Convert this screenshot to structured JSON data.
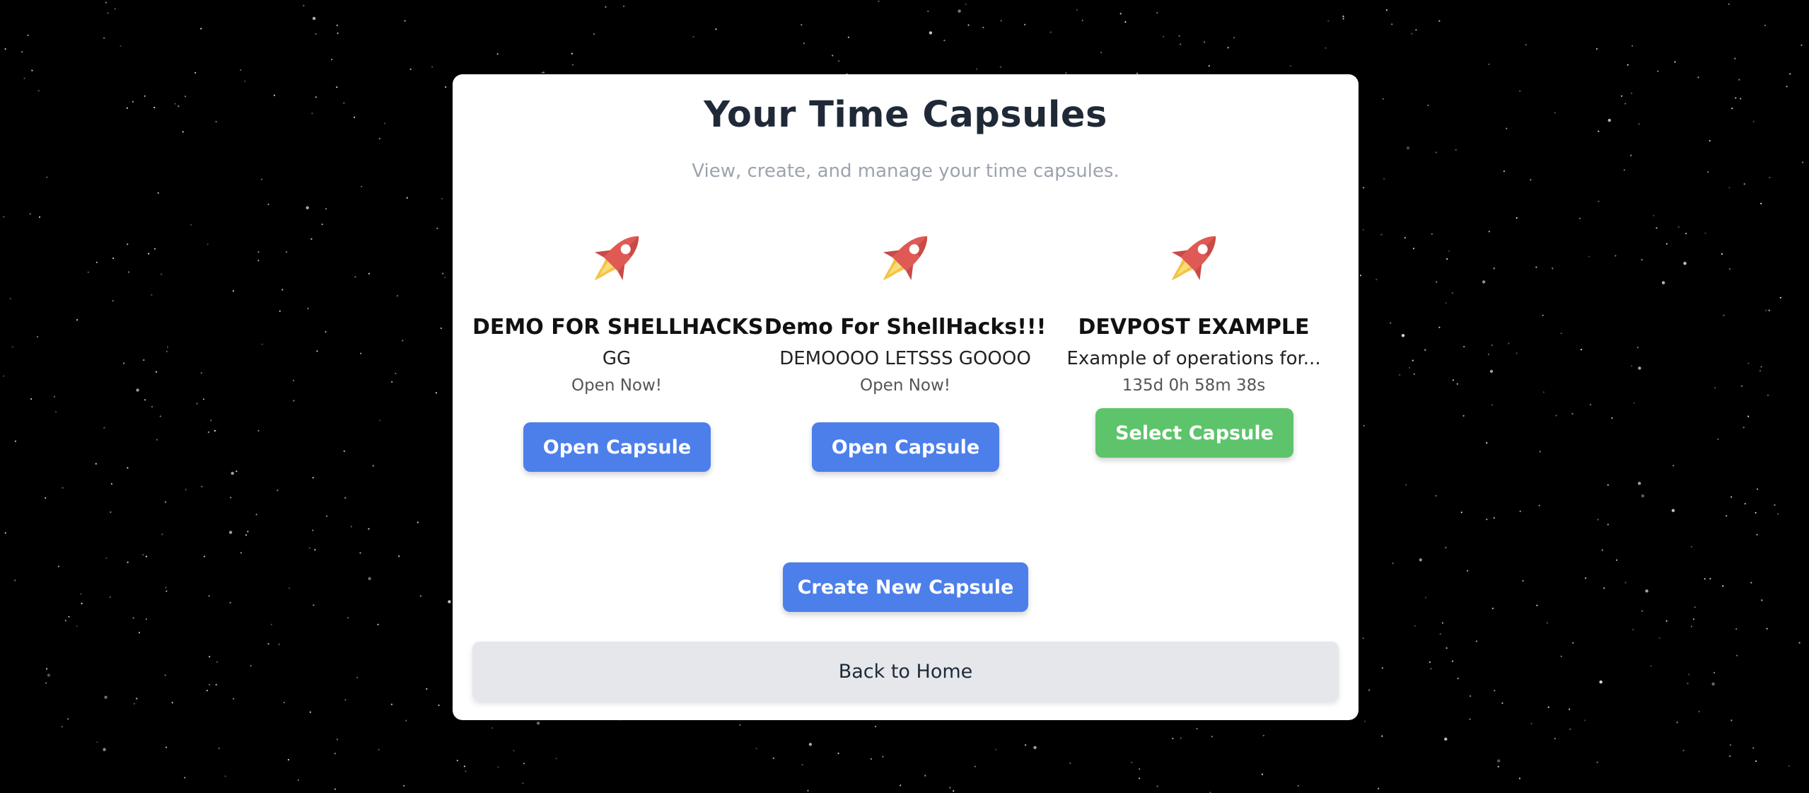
{
  "page": {
    "title": "Your Time Capsules",
    "subtitle": "View, create, and manage your time capsules."
  },
  "capsules": [
    {
      "icon": "rocket-icon",
      "title": "DEMO FOR SHELLHACKS",
      "description": "GG",
      "status": "Open Now!",
      "button_label": "Open Capsule",
      "button_color": "#4c7fea"
    },
    {
      "icon": "rocket-icon",
      "title": "Demo For ShellHacks!!!",
      "description": "DEMOOOO LETSSS GOOOO",
      "status": "Open Now!",
      "button_label": "Open Capsule",
      "button_color": "#4c7fea"
    },
    {
      "icon": "rocket-icon",
      "title": "DEVPOST EXAMPLE",
      "description": "Example of operations for...",
      "status": "135d 0h 58m 38s",
      "button_label": "Select Capsule",
      "button_color": "#5dc46b"
    }
  ],
  "actions": {
    "create_label": "Create New Capsule",
    "home_label": "Back to Home"
  },
  "colors": {
    "background": "#000000",
    "panel": "#ffffff",
    "primary_button": "#4c7fea",
    "select_button": "#5dc46b",
    "secondary_button": "#e5e7eb",
    "rocket_body": "#e05a55",
    "rocket_flame": "#f5c242"
  }
}
